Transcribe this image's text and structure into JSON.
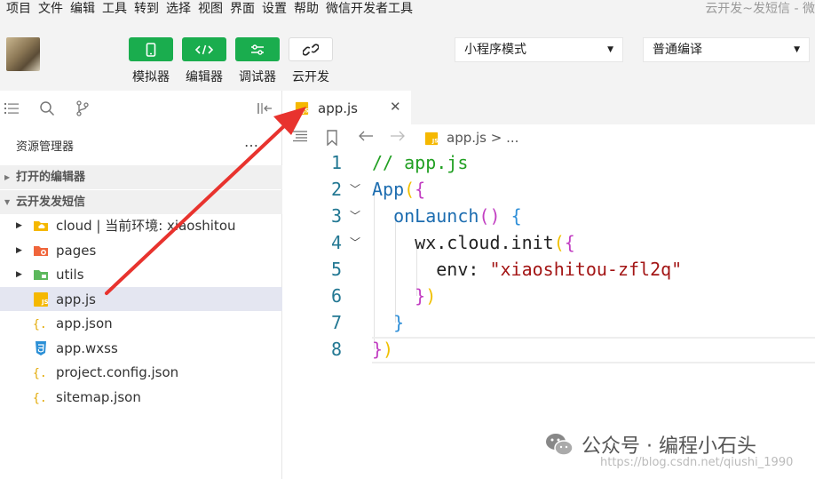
{
  "menu": {
    "items": [
      "项目",
      "文件",
      "编辑",
      "工具",
      "转到",
      "选择",
      "视图",
      "界面",
      "设置",
      "帮助",
      "微信开发者工具"
    ],
    "window_title": "云开发~发短信 - 微"
  },
  "toolbar": {
    "buttons": [
      {
        "label": "模拟器",
        "icon": "phone-icon"
      },
      {
        "label": "编辑器",
        "icon": "code-icon"
      },
      {
        "label": "调试器",
        "icon": "sliders-icon"
      },
      {
        "label": "云开发",
        "icon": "link-icon"
      }
    ],
    "mode_select": "小程序模式",
    "compile_select": "普通编译"
  },
  "explorer": {
    "title": "资源管理器",
    "more": "…",
    "open_editors": "打开的编辑器",
    "project": "云开发发短信",
    "items": [
      {
        "name": "cloud | 当前环境: xiaoshitou",
        "type": "folder",
        "icon": "cloud-folder-icon"
      },
      {
        "name": "pages",
        "type": "folder",
        "icon": "pages-folder-icon"
      },
      {
        "name": "utils",
        "type": "folder",
        "icon": "utils-folder-icon"
      },
      {
        "name": "app.js",
        "type": "js",
        "icon": "js-file-icon",
        "selected": true
      },
      {
        "name": "app.json",
        "type": "json",
        "icon": "json-file-icon"
      },
      {
        "name": "app.wxss",
        "type": "wxss",
        "icon": "css-file-icon"
      },
      {
        "name": "project.config.json",
        "type": "json",
        "icon": "json-file-icon"
      },
      {
        "name": "sitemap.json",
        "type": "json",
        "icon": "json-file-icon"
      }
    ]
  },
  "editor": {
    "tab_label": "app.js",
    "tab_close": "✕",
    "breadcrumb": "app.js > ...",
    "lines": [
      {
        "n": "1",
        "comment": "// app.js"
      },
      {
        "n": "2",
        "ident": "App",
        "b1": "(",
        "b2": "{"
      },
      {
        "n": "3",
        "fn": "onLaunch",
        "b2": "()",
        "b3": "{"
      },
      {
        "n": "4",
        "ident": "wx.cloud.init",
        "b1": "(",
        "b2": "{"
      },
      {
        "n": "5",
        "key": "env: ",
        "string": "\"xiaoshitou-zfl2q\""
      },
      {
        "n": "6",
        "b2": "}",
        "b1": ")"
      },
      {
        "n": "7",
        "b3": "}"
      },
      {
        "n": "8",
        "b2": "}",
        "b1": ")"
      }
    ]
  },
  "watermark": {
    "text": "公众号 · 编程小石头",
    "url": "https://blog.csdn.net/qiushi_1990"
  },
  "colors": {
    "accent_green": "#1aad4e",
    "arrow_red": "#e8332e",
    "selection": "#e4e6f1"
  }
}
